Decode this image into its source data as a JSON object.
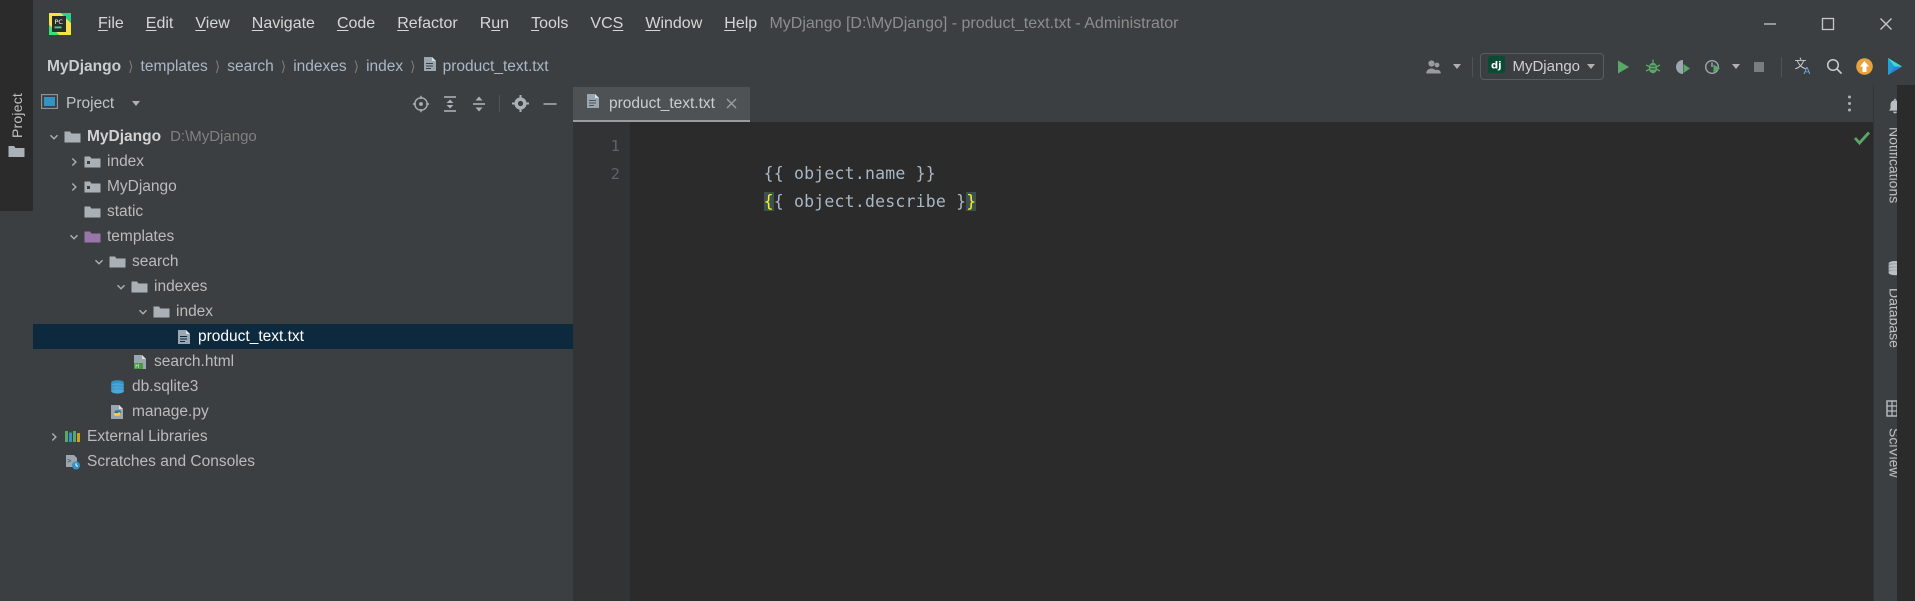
{
  "window": {
    "title": "MyDjango [D:\\MyDjango] - product_text.txt - Administrator",
    "controls": {
      "minimize": "minimize-icon",
      "maximize": "maximize-icon",
      "close": "close-icon"
    },
    "logo": "pycharm-logo-icon"
  },
  "menubar": {
    "items": [
      {
        "label": "File",
        "mnemonic": "F"
      },
      {
        "label": "Edit",
        "mnemonic": "E"
      },
      {
        "label": "View",
        "mnemonic": "V"
      },
      {
        "label": "Navigate",
        "mnemonic": "N"
      },
      {
        "label": "Code",
        "mnemonic": "C"
      },
      {
        "label": "Refactor",
        "mnemonic": "R"
      },
      {
        "label": "Run",
        "mnemonic": "u"
      },
      {
        "label": "Tools",
        "mnemonic": "T"
      },
      {
        "label": "VCS",
        "mnemonic": "S"
      },
      {
        "label": "Window",
        "mnemonic": "W"
      },
      {
        "label": "Help",
        "mnemonic": "H"
      }
    ]
  },
  "breadcrumb": {
    "separator": "〉",
    "items": [
      {
        "label": "MyDjango"
      },
      {
        "label": "templates"
      },
      {
        "label": "search"
      },
      {
        "label": "indexes"
      },
      {
        "label": "index"
      },
      {
        "label": "product_text.txt",
        "icon": "text-file-icon"
      }
    ]
  },
  "toolbar": {
    "account_icon": "user-account-icon",
    "run_config": {
      "label": "MyDjango",
      "icon": "django-icon"
    },
    "buttons": [
      {
        "name": "run-button",
        "icon": "play-icon",
        "color": "#5d9e4f"
      },
      {
        "name": "debug-button",
        "icon": "bug-icon",
        "color": "#5d9e4f"
      },
      {
        "name": "run-with-coverage-button",
        "icon": "coverage-icon",
        "color": "#5d9e4f"
      },
      {
        "name": "profile-button",
        "icon": "profiler-icon",
        "color": "#5d9e4f"
      },
      {
        "name": "stop-button",
        "icon": "stop-square-icon",
        "color": "#7a7d7f"
      },
      {
        "name": "translate-button",
        "icon": "translate-icon",
        "color": "#b0b8c0"
      },
      {
        "name": "search-everywhere-button",
        "icon": "search-icon",
        "color": "#b0b8c0"
      },
      {
        "name": "update-project-button",
        "icon": "update-arrow-icon",
        "color": "#e8a33d"
      },
      {
        "name": "ide-feature-button",
        "icon": "colorful-play-icon",
        "color": "#3dc5b0"
      }
    ]
  },
  "left_strip": {
    "project_label": "Project",
    "icon": "folder-icon"
  },
  "project_panel": {
    "title": "Project",
    "title_icon": "project-view-icon",
    "tools": [
      {
        "name": "select-opened-file-button",
        "icon": "target-icon"
      },
      {
        "name": "expand-all-button",
        "icon": "expand-all-icon"
      },
      {
        "name": "collapse-all-button",
        "icon": "collapse-all-icon"
      },
      {
        "name": "panel-settings-button",
        "icon": "gear-icon"
      },
      {
        "name": "hide-panel-button",
        "icon": "minimize-icon"
      }
    ],
    "tree": [
      {
        "label": "MyDjango",
        "path": "D:\\MyDjango",
        "depth": 0,
        "arrow": "down",
        "icon": "module-folder-icon",
        "bold": true,
        "selected": false
      },
      {
        "label": "index",
        "path": "",
        "depth": 1,
        "arrow": "right",
        "icon": "source-folder-icon",
        "bold": false,
        "selected": false
      },
      {
        "label": "MyDjango",
        "path": "",
        "depth": 1,
        "arrow": "right",
        "icon": "source-folder-icon",
        "bold": false,
        "selected": false
      },
      {
        "label": "static",
        "path": "",
        "depth": 1,
        "arrow": "none",
        "icon": "folder-icon",
        "bold": false,
        "selected": false
      },
      {
        "label": "templates",
        "path": "",
        "depth": 1,
        "arrow": "down",
        "icon": "template-folder-icon",
        "bold": false,
        "selected": false
      },
      {
        "label": "search",
        "path": "",
        "depth": 2,
        "arrow": "down",
        "icon": "folder-icon",
        "bold": false,
        "selected": false
      },
      {
        "label": "indexes",
        "path": "",
        "depth": 3,
        "arrow": "down",
        "icon": "folder-icon",
        "bold": false,
        "selected": false
      },
      {
        "label": "index",
        "path": "",
        "depth": 4,
        "arrow": "down",
        "icon": "folder-icon",
        "bold": false,
        "selected": false
      },
      {
        "label": "product_text.txt",
        "path": "",
        "depth": 5,
        "arrow": "none",
        "icon": "text-file-icon",
        "bold": false,
        "selected": true
      },
      {
        "label": "search.html",
        "path": "",
        "depth": 3,
        "arrow": "none",
        "icon": "html-file-icon",
        "bold": false,
        "selected": false
      },
      {
        "label": "db.sqlite3",
        "path": "",
        "depth": 2,
        "arrow": "none",
        "icon": "database-file-icon",
        "bold": false,
        "selected": false
      },
      {
        "label": "manage.py",
        "path": "",
        "depth": 2,
        "arrow": "none",
        "icon": "python-file-icon",
        "bold": false,
        "selected": false
      },
      {
        "label": "External Libraries",
        "path": "",
        "depth": 0,
        "arrow": "right",
        "icon": "libraries-icon",
        "bold": false,
        "selected": false
      },
      {
        "label": "Scratches and Consoles",
        "path": "",
        "depth": 0,
        "arrow": "none",
        "icon": "scratches-icon",
        "bold": false,
        "selected": false
      }
    ]
  },
  "editor": {
    "tab": {
      "label": "product_text.txt",
      "icon": "text-file-icon",
      "close": "close-icon"
    },
    "options_icon": "more-options-icon",
    "inspection_status": "ok-check-icon",
    "lines": [
      {
        "number": "1",
        "segments": [
          {
            "text": "{{ object.name }}",
            "style": "plain"
          }
        ]
      },
      {
        "number": "2",
        "segments": [
          {
            "text": "{",
            "style": "brace-highlight"
          },
          {
            "text": "{ object.describe }",
            "style": "plain"
          },
          {
            "text": "}",
            "style": "brace-highlight"
          }
        ]
      }
    ]
  },
  "right_strip": {
    "items": [
      {
        "label": "Notifications",
        "icon": "bell-icon"
      },
      {
        "label": "Database",
        "icon": "database-icon"
      },
      {
        "label": "SciView",
        "icon": "grid-icon"
      }
    ]
  },
  "colors": {
    "bg_chrome": "#3c3f41",
    "bg_editor": "#2b2b2b",
    "bg_gutter": "#313335",
    "selection": "#0d293e",
    "accent_green": "#5d9e4f",
    "text": "#bbbbbb",
    "code_text": "#a9b7c6",
    "brace_highlight_bg": "#3b514d",
    "brace_highlight_fg": "#ffef28"
  }
}
